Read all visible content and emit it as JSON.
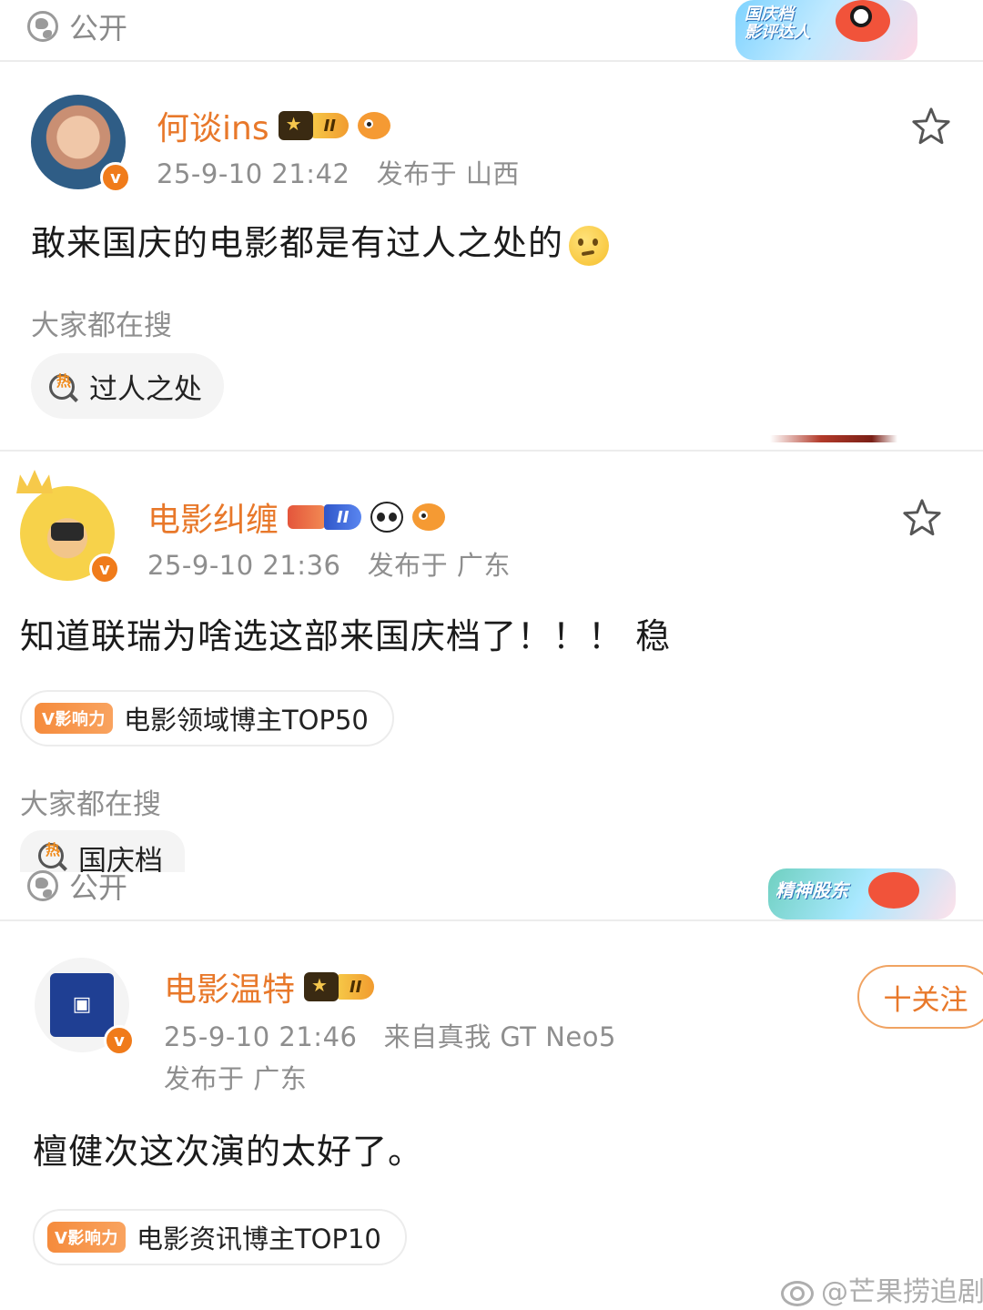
{
  "top": {
    "visibility_label": "公开",
    "banner_label": "国庆档\n影评达人"
  },
  "posts": [
    {
      "username": "何谈ins",
      "level_badge": "II",
      "timestamp": "25-9-10 21:42",
      "location": "发布于 山西",
      "text": "敢来国庆的电影都是有过人之处的",
      "section_label": "大家都在搜",
      "hot_search": "过人之处"
    },
    {
      "username": "电影纠缠",
      "level_badge": "II",
      "timestamp": "25-9-10 21:36",
      "location": "发布于 广东",
      "text": "知道联瑞为啥选这部来国庆档了！！！ 稳",
      "influence_tag": "V影响力",
      "influence_label": "电影领域博主TOP50",
      "section_label": "大家都在搜",
      "hot_search": "国庆档"
    },
    {
      "visibility_label": "公开",
      "banner_label": "精神股东",
      "username": "电影温特",
      "level_badge": "II",
      "timestamp": "25-9-10 21:46",
      "device": "来自真我 GT Neo5",
      "location": "发布于 广东",
      "follow_label": "十关注",
      "text": "檀健次这次演的太好了。",
      "influence_tag": "V影响力",
      "influence_label": "电影资讯博主TOP10"
    }
  ],
  "watermark": "@芒果捞追剧",
  "verified_badge": "v",
  "colors": {
    "username": "#e8782a",
    "accent": "#f07b1a",
    "meta": "#8e8e8e"
  }
}
